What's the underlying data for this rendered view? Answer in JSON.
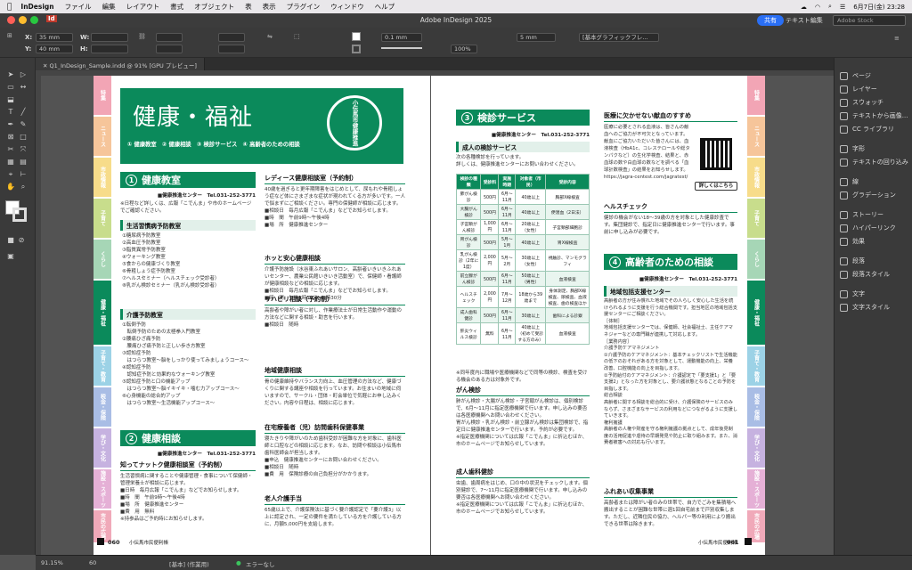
{
  "menubar": {
    "app": "InDesign",
    "items": [
      "ファイル",
      "編集",
      "レイアウト",
      "書式",
      "オブジェクト",
      "表",
      "表示",
      "プラグイン",
      "ウィンドウ",
      "ヘルプ"
    ],
    "datetime": "6月7日(金) 23:28"
  },
  "titlebar": {
    "title": "Adobe InDesign 2025",
    "share": "共有",
    "workspace": "テキスト編集",
    "stock_placeholder": "Adobe Stock"
  },
  "control": {
    "x": "35 mm",
    "y": "40 mm",
    "w_label": "W:",
    "h_label": "H:",
    "x_label": "X:",
    "y_label": "Y:",
    "stroke": "0.1 mm",
    "zoom": "100%",
    "width": "5 mm",
    "style": "[基本グラフィックフレ..."
  },
  "doctab": {
    "name": "Q1_InDesign_Sample.indd @ 91% [GPU プレビュー]"
  },
  "panels": [
    "ページ",
    "レイヤー",
    "スウォッチ",
    "テキストから画像...",
    "CC ライブラリ",
    "字形",
    "テキストの回り込み",
    "線",
    "グラデーション",
    "ストーリー",
    "ハイパーリンク",
    "効果",
    "段落",
    "段落スタイル",
    "文字",
    "文字スタイル"
  ],
  "status": {
    "zoom": "91.15%",
    "page": "60",
    "master": "[基本] (作業用)",
    "errors": "エラーなし"
  },
  "tabs": [
    "特集",
    "ニュース",
    "市政情報",
    "子育て",
    "くらし",
    "健康・福祉",
    "子育て・教育",
    "税金・保険",
    "学び・文化",
    "施設・スポーツ",
    "市民の広場"
  ],
  "left": {
    "banner_title": "健康・福祉",
    "banner_links": "① 健康教室　② 健康相談　③ 検診サービス　④ 高齢者のための相談",
    "stamp": "小伝馬市健康推進",
    "sec1": {
      "num": "1",
      "title": "健康教室",
      "contact": "■健康推進センター　Tel.031-252-3771",
      "intro": "※日程など詳しくは、広報「こでんま」や市のホームページでご確認ください。"
    },
    "s1a": {
      "head": "生活習慣病予防教室",
      "body": "①糖尿病予防教室\n②高血圧予防教室\n③脂質異常予防教室\n④ウォーキング教室\n⑤食からの健康づくり教室\n⑥骨粗しょう症予防教室\n⑦ヘルスセミナー（ヘルスチェック受診者）\n⑧乳がん検診セミナー（乳がん検診受診者）"
    },
    "s1b": {
      "head": "介護予防教室",
      "body": "①転倒予防\n　転倒予防のための太極拳入門教室\n②腰痛ひざ痛予防\n　腰痛ひざ痛予防と正しい歩き方教室\n③認知症予防\n　はつらつ教室〜脳をしっかり使ってみましょうコース〜\n④認知症予防\n　認知症予防と効果的なウォーキング教室\n⑤認知症予防と口の機能アップ\n　はつらつ教室〜脳イキイキ・噛む力アップコース〜\n⑥心身機能の総合的アップ\n　はつらつ教室〜生活機能アップコース〜"
    },
    "sec2": {
      "num": "2",
      "title": "健康相談",
      "contact": "■健康推進センター　Tel.031-252-3771"
    },
    "s2a": {
      "head": "知ってナットク健康相談室（予約制）",
      "body": "生活習慣病に関することや健康管理・食事について保健師・管理栄養士が相談に応じます。\n■日時　毎月広報「こでんま」などでお知らせします。\n■時　間　午前9時〜午後4時\n■場　所　健康推進センター\n■費　用　無料\n※持参品はご予約時にお知らせします。"
    },
    "s2b": {
      "head": "レディース健康相談室（予約制）",
      "body": "40歳を過ぎると更年期障害をはじめとして、尿もれや骨粗しょう症など体にさまざまな症状が現われてくる方が多いです。一人で悩まずにご相談ください。専門の保健師が相談に応じます。\n■相談日　毎月広報「こでんま」などでお知らせします。\n■時　間　午前9時〜午後4時\n■場　所　健康推進センター"
    },
    "s2c": {
      "head": "ホッと安心健康相談",
      "body": "介護予防施設（水谷東ふれあいサロン、高齢者いきいきふれあいセンター、農業公民館いきいき活動室）で、保健師・看護師が健康相談などの相談に応じます。\n■相談日　毎月広報「こでんま」などでお知らせします。\n■時　間　午後1時30分〜3時30分"
    },
    "s2d": {
      "head": "リハビリ相談（予約制）",
      "body": "高齢者や障がい者に対し、作業療法士が日常生活動作や運動の方法などに関する相談・助言を行います。\n■相談日　随時"
    },
    "s2e": {
      "head": "地域健康相談",
      "body": "骨の健康維持やバランス力向上、血圧管理の方法など、健康づくりに関する講座や相談を行っています。お住まいの地域に伺いますので、サークル・団体・町会単位で気軽にお申し込みください。内容や日程は、相談に応じます。"
    },
    "s2f": {
      "head": "在宅療養者（児）訪問歯科保健事業",
      "body": "寝たきりや障がいのため歯科受診が困難な方を対象に、歯科医師と口腔などの相談に応じます。なお、訪問や相談は小伝馬市歯科医師会が担当します。\n■申込　健康推進センターにお問い合わせください。\n■相談日　随時\n■費　用　保険診療の自己負担分がかかります。"
    },
    "s2g": {
      "head": "老人介護手当",
      "body": "65歳以上で、介護保険法に基づく要介護認定で「要介護3」以上に認定され、一定の要件を満たしている方を介護している方に、月額5,000円を支給します。"
    },
    "footer": {
      "page": "060",
      "name": "小伝馬市民便利帳"
    }
  },
  "right": {
    "sec3": {
      "num": "3",
      "title": "検診サービス",
      "contact": "■健康推進センター　Tel.031-252-3771"
    },
    "s3a": {
      "head": "成人の検診サービス",
      "body": "次の各種検診を行っています。\n詳しくは、健康推進センターにお問い合わせください。"
    },
    "table": {
      "headers": [
        "検診の種類",
        "受診料",
        "実施時期",
        "対象者（市民）",
        "受診内容"
      ],
      "rows": [
        [
          "肺がん検診",
          "500円",
          "6月〜11月",
          "40歳以上",
          "胸部X線検査"
        ],
        [
          "大腸がん検診",
          "500円",
          "6月〜11月",
          "40歳以上",
          "便潜血（2日法）"
        ],
        [
          "子宮頸がん検診",
          "1,000円",
          "6月〜11月",
          "20歳以上（女性）",
          "子宮頸部細胞診"
        ],
        [
          "胃がん検診",
          "500円",
          "5月〜1月",
          "40歳以上",
          "胃X線検査"
        ],
        [
          "乳がん検診（2年に1度）",
          "2,000円",
          "5月〜2月",
          "30歳以上（女性）",
          "視触診、マンモグラフィ"
        ],
        [
          "前立腺がん検診",
          "500円",
          "6月〜11月",
          "50歳以上（男性）",
          "血液検査"
        ],
        [
          "ヘルスチェック",
          "2,000円",
          "7月〜12月",
          "18歳から39歳まで",
          "身体測定、胸部X線検査、尿検査、血液検査、歯の検査ほか"
        ],
        [
          "成人歯科健診",
          "500円",
          "6月〜11月",
          "30歳以上",
          "歯科による診察"
        ],
        [
          "肝炎ウィルス検診",
          "無料",
          "6月〜11月",
          "40歳以上（初めて受診する方のみ）",
          "血液検査"
        ]
      ]
    },
    "note1": "※同年度内に職場や医療機関などで同等の検診、検査を受ける機会のある方は対象外です。",
    "s3b": {
      "head": "がん検診",
      "body": "肺がん検診・大腸がん検診・子宮頸がん検診は、個別検診で、6月〜11月に指定医療機関で行います。申し込みの要否は各医療機関へお問い合わせください。\n胃がん検診・乳がん検診・前立腺がん検診は集団検診で、指定日に健康推進センターで行います。予約が必要です。\n※指定医療機関については広報「こでんま」に折込むほか、市のホームページでお知らせしています。"
    },
    "s3c": {
      "head": "成人歯科健診",
      "body": "虫歯、歯周病をはじめ、口の中の状況をチェックします。個別健診で、7〜11月に指定医療機関で行います。申し込みの要否は各医療機関へお問い合わせください。\n※指定医療機関については広報「こでんま」に折込むほか、市のホームページでお知らせしています。"
    },
    "s3d": {
      "head": "医療に欠かせない献血のすすめ",
      "body": "医療に必要とされる血液は、皆さんの献血へのご協力が不可欠となっています。\n献血にご協力いただいた皆さんには、血液検査（HbA1c、コレステロールや総タンパクなど）の生化学検査、結果と、赤血球の数や白血球の数などを調べる「血球計数検査」の結果をお知らせします。\nhttps://jagra-centest.com/jagratest/",
      "btn": "詳しくはこちら"
    },
    "s3e": {
      "head": "ヘルスチェック",
      "body": "健診の機会がない18〜39歳の方を対象とした健康診査です。集団健診で、指定日に健康推進センターで行います。事前に申し込みが必要です。"
    },
    "sec4": {
      "num": "4",
      "title": "高齢者のための相談",
      "contact": "■健康推進センター　Tel.031-252-3771"
    },
    "s4a": {
      "head": "地域包括支援センター",
      "body": "高齢者の方が住み慣れた地域でその人らしく安心した生活を続けられるように支援を行う総合機関です。担当地区の地域包括支援センターにご相談ください。\n［体制］\n地域包括支援センターでは、保健師、社会福祉士、主任ケアマネジャーなどの専門職が連携して対応します。\n［業務内容］\n介護予防ケアマネジメント\n①介護予防のケアマネジメント：基本チェックリストで生活機能の低下のおそれがある方を対象として、運動機能の向上、栄養改善、口腔機能の向上を目指します。\n②予防給付のケアマネジメント：介護認定で「要支援1」と「要支援2」となった方を対象とし、要介護状態となることの予防を目指します。\n総合相談\n高齢者に関する相談を総合的に受け、介護保険のサービスのみならず、さまざまなサービスの利用などにつながるように支援していきます。\n権利擁護\n高齢者の人権や財産を守る権利擁護の拠点として、成年後見制度の活用促進や虐待の早期発見や防止に取り組みます。また、消費者被害への対応も行います。"
    },
    "s4b": {
      "head": "ふれあい収集事業",
      "body": "高齢者または障がい者のみの世帯で、自力でごみを集積場へ搬出することが困難な世帯に週1回自宅前まで戸別収集します。ただし、近隣住民の協力、ヘルパー等の利用により搬出できる世帯は除きます。"
    },
    "footer": {
      "page": "061",
      "name": "小伝馬市民便利帳"
    }
  }
}
